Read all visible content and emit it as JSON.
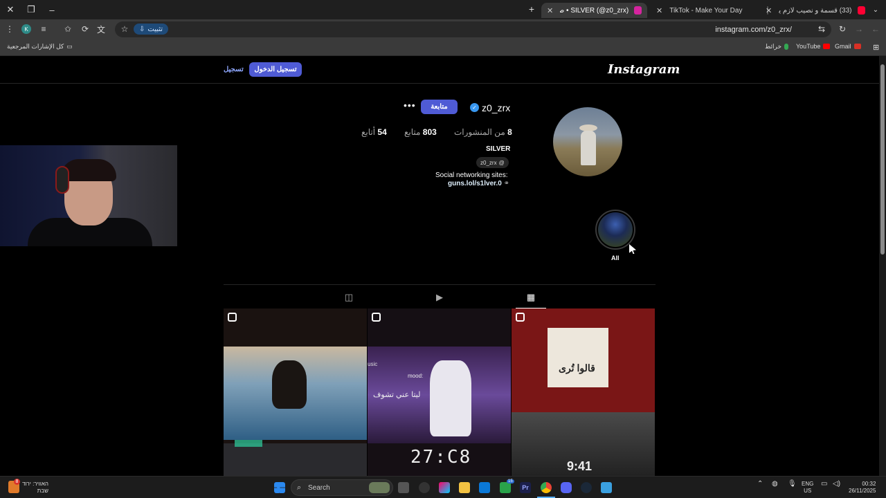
{
  "browser": {
    "tabs": [
      {
        "title": "(33) قسمة و نصيب لازم يتوقف!..",
        "favicon_color": "#ff0033",
        "active": false
      },
      {
        "title": "TikTok - Make Your Day",
        "favicon_color": "#111111",
        "active": false
      },
      {
        "title": "SILVER (@z0_zrx) • صور ومقاط...",
        "favicon_color": "#d6249f",
        "active": true
      }
    ],
    "new_tab": "+",
    "url": "instagram.com/z0_zrx/",
    "install_label": "تثبيت",
    "profile_initial": "K"
  },
  "bookmarks": [
    {
      "label": "Gmail",
      "color": "#d93025"
    },
    {
      "label": "YouTube",
      "color": "#ff0000"
    },
    {
      "label": "خرائط",
      "color": "#34a853"
    }
  ],
  "bookmarks_all": "كل الإشارات المرجعية",
  "instagram": {
    "logo": "Instagram",
    "login_label": "تسجيل الدخول",
    "signup_label": "تسجيل",
    "username": "z0_zrx",
    "follow_label": "متابعة",
    "more": "•••",
    "stats": {
      "posts_num": "8",
      "posts_label": "من المنشورات",
      "followers_num": "803",
      "followers_label": "متابع",
      "following_num": "54",
      "following_label": "أتابع"
    },
    "full_name": "SILVER",
    "threads_handle": "z0_zrx",
    "bio": "Social networking sites:",
    "link": "guns.lol/s1lver.0",
    "highlight_label": "All"
  },
  "posts_overlay_texts": {
    "post2_top": "usic",
    "post2_mood": "mood:",
    "post2_arabic": "ليتا عني تشوف",
    "post3_arabic": "قالوا تُرى",
    "post2_clock": "27:C8",
    "post3_clock": "9:41"
  },
  "taskbar": {
    "search_label": "Search",
    "weather_line1": "האוויר: ירוד",
    "weather_line2": "שבת",
    "lang_line1": "ENG",
    "lang_line2": "US",
    "time": "00:32",
    "date": "26/11/2025",
    "notif_badge": "8",
    "badge_15": "15"
  }
}
